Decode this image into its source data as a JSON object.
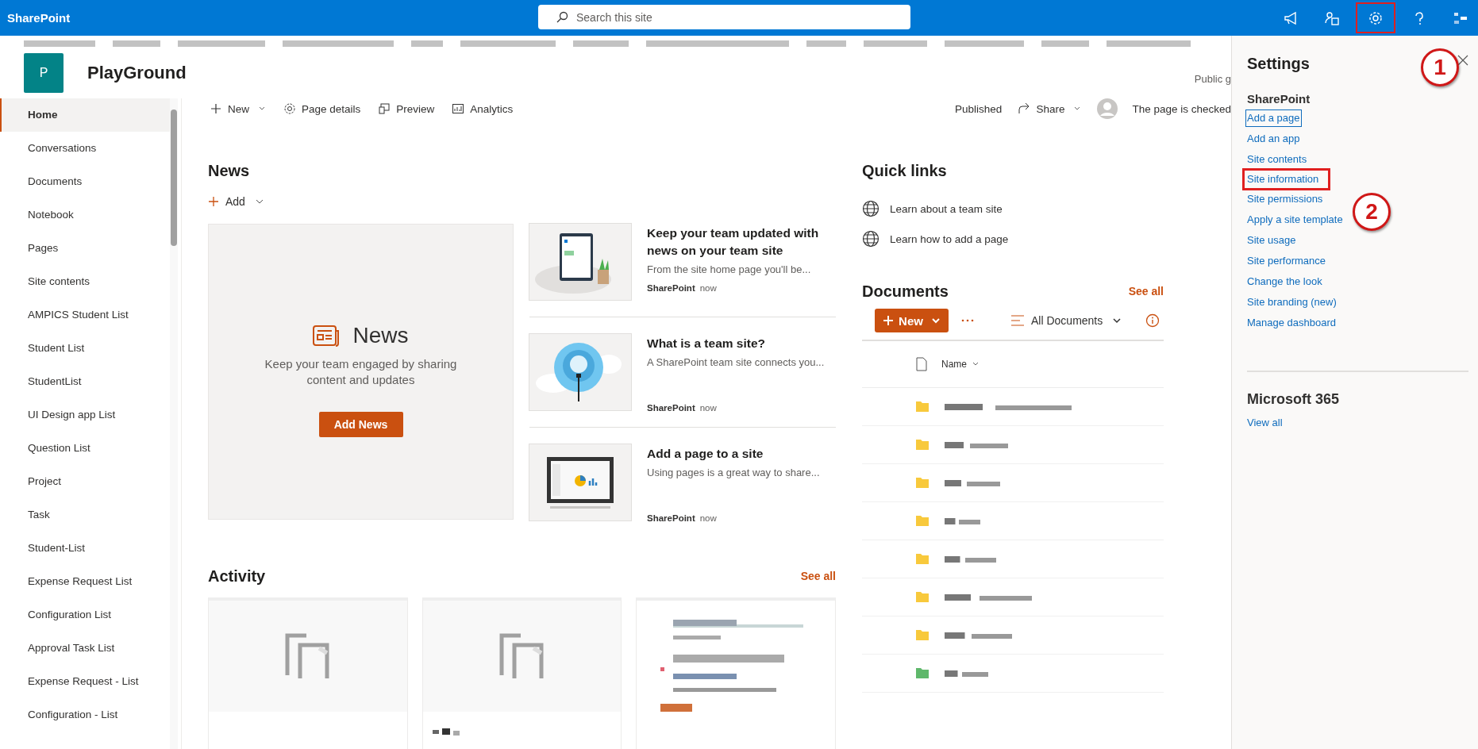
{
  "top_bar": {
    "app_name": "SharePoint",
    "search": {
      "placeholder": "Search this site"
    },
    "icons": [
      {
        "kind": "megaphone",
        "annotated": false
      },
      {
        "kind": "people",
        "annotated": false
      },
      {
        "kind": "settings",
        "annotated": true
      },
      {
        "kind": "help",
        "annotated": false
      },
      {
        "kind": "apps",
        "annotated": false
      }
    ]
  },
  "site_header": {
    "logo_letter": "P",
    "title": "PlayGround",
    "privacy": "Public g"
  },
  "nav": {
    "items": [
      {
        "label": "Home",
        "selected": true
      },
      {
        "label": "Conversations",
        "selected": false
      },
      {
        "label": "Documents",
        "selected": false
      },
      {
        "label": "Notebook",
        "selected": false
      },
      {
        "label": "Pages",
        "selected": false
      },
      {
        "label": "Site contents",
        "selected": false
      },
      {
        "label": "AMPICS Student List",
        "selected": false
      },
      {
        "label": "Student List",
        "selected": false
      },
      {
        "label": "StudentList",
        "selected": false
      },
      {
        "label": "UI Design app List",
        "selected": false
      },
      {
        "label": "Question List",
        "selected": false
      },
      {
        "label": "Project",
        "selected": false
      },
      {
        "label": "Task",
        "selected": false
      },
      {
        "label": "Student-List",
        "selected": false
      },
      {
        "label": "Expense Request List",
        "selected": false
      },
      {
        "label": "Configuration List",
        "selected": false
      },
      {
        "label": "Approval Task List",
        "selected": false
      },
      {
        "label": "Expense Request - List",
        "selected": false
      },
      {
        "label": "Configuration - List",
        "selected": false
      }
    ]
  },
  "command_bar": {
    "left": [
      {
        "kind": "new",
        "label": "New"
      },
      {
        "kind": "details",
        "label": "Page details"
      },
      {
        "kind": "preview",
        "label": "Preview"
      },
      {
        "kind": "analytics",
        "label": "Analytics"
      }
    ],
    "status": "Published",
    "share": "Share",
    "checkout": "The page is checked"
  },
  "news": {
    "title": "News",
    "add": "Add",
    "placeholder": {
      "title": "News",
      "text": "Keep your team engaged by sharing content and updates",
      "button": "Add News"
    },
    "cards": [
      {
        "kind": "tablet",
        "title": "Keep your team updated with news on your team site",
        "description": "From the site home page you'll be...",
        "source": "SharePoint",
        "time": "now"
      },
      {
        "kind": "bulb",
        "title": "What is a team site?",
        "description": "A SharePoint team site connects you...",
        "source": "SharePoint",
        "time": "now"
      },
      {
        "kind": "monitor",
        "title": "Add a page to a site",
        "description": "Using pages is a great way to share...",
        "source": "SharePoint",
        "time": "now"
      }
    ]
  },
  "activity": {
    "title": "Activity",
    "see_all": "See all",
    "cards": [
      {
        "kind": "placeholder"
      },
      {
        "kind": "placeholder"
      },
      {
        "kind": "preview"
      }
    ]
  },
  "quick_links": {
    "title": "Quick links",
    "links": [
      "Learn about a team site",
      "Learn how to add a page"
    ]
  },
  "documents": {
    "title": "Documents",
    "see_all": "See all",
    "new_button": "New",
    "view": "All Documents",
    "column": "Name",
    "rows": [
      {
        "color": "#f8c93c"
      },
      {
        "color": "#f8c93c"
      },
      {
        "color": "#f8c93c"
      },
      {
        "color": "#f8c93c"
      },
      {
        "color": "#f8c93c"
      },
      {
        "color": "#f8c93c"
      },
      {
        "color": "#f8c93c"
      },
      {
        "color": "#5fb86b"
      }
    ]
  },
  "settings": {
    "title": "Settings",
    "sections": [
      {
        "title": "SharePoint",
        "links": [
          {
            "label": "Add a page",
            "focused": true,
            "annotated": false
          },
          {
            "label": "Add an app",
            "focused": false,
            "annotated": false
          },
          {
            "label": "Site contents",
            "focused": false,
            "annotated": false
          },
          {
            "label": "Site information",
            "focused": false,
            "annotated": true
          },
          {
            "label": "Site permissions",
            "focused": false,
            "annotated": false
          },
          {
            "label": "Apply a site template",
            "focused": false,
            "annotated": false
          },
          {
            "label": "Site usage",
            "focused": false,
            "annotated": false
          },
          {
            "label": "Site performance",
            "focused": false,
            "annotated": false
          },
          {
            "label": "Change the look",
            "focused": false,
            "annotated": false
          },
          {
            "label": "Site branding (new)",
            "focused": false,
            "annotated": false
          },
          {
            "label": "Manage dashboard",
            "focused": false,
            "annotated": false
          }
        ]
      },
      {
        "title": "Microsoft 365",
        "links": [
          {
            "label": "View all",
            "focused": false,
            "annotated": false
          }
        ]
      }
    ]
  },
  "callouts": [
    "1",
    "2"
  ]
}
